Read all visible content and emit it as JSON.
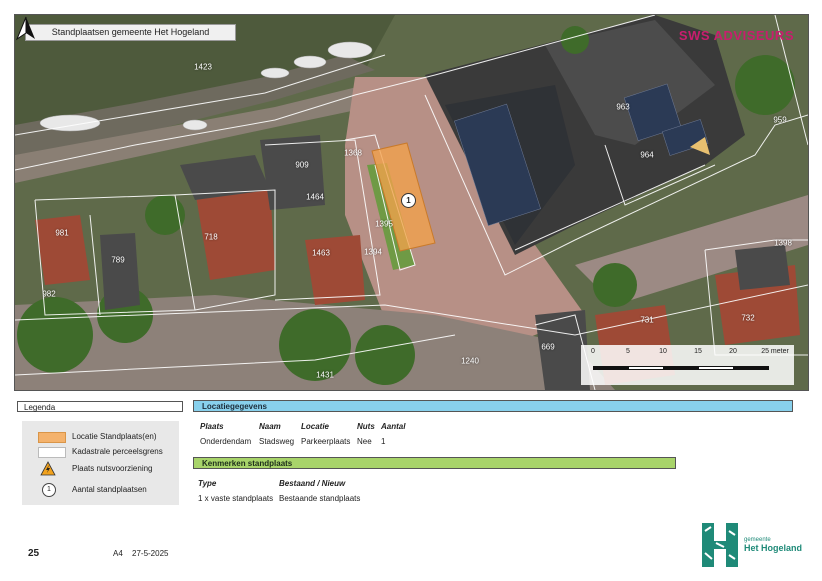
{
  "map": {
    "title": "Standplaatsen gemeente Het Hogeland",
    "brand": "SWS ADVISEURS",
    "parcel_labels": [
      "1423",
      "963",
      "959",
      "964",
      "909",
      "1368",
      "1464",
      "1395",
      "718",
      "1463",
      "1394",
      "981",
      "789",
      "982",
      "1398",
      "732",
      "731",
      "669",
      "1240",
      "1431"
    ],
    "site_marker": "1",
    "scale": {
      "ticks": [
        "0",
        "5",
        "10",
        "15",
        "20",
        "25 meter"
      ]
    },
    "colors": {
      "standplaats": "#f4b26c",
      "parcel_border": "#ffffff"
    }
  },
  "legend": {
    "title": "Legenda",
    "items": [
      {
        "symbol": "orange-rectangle",
        "label": "Locatie Standplaats(en)"
      },
      {
        "symbol": "white-rectangle",
        "label": "Kadastrale perceelsgrens"
      },
      {
        "symbol": "warning-icon",
        "label": "Plaats nutsvoorziening"
      },
      {
        "symbol": "number-circle",
        "symbol_text": "1",
        "label": "Aantal standplaatsen"
      }
    ]
  },
  "location": {
    "title": "Locatiegegevens",
    "headers": [
      "Plaats",
      "Naam",
      "Locatie",
      "Nuts",
      "Aantal"
    ],
    "row": [
      "Onderdendam",
      "Stadsweg",
      "Parkeerplaats",
      "Nee",
      "1"
    ]
  },
  "kenmerken": {
    "title": "Kenmerken standplaats",
    "headers": [
      "Type",
      "Bestaand / Nieuw"
    ],
    "row": [
      "1 x vaste standplaats",
      "Bestaande standplaats"
    ]
  },
  "footer": {
    "page_number": "25",
    "paper_size": "A4",
    "date": "27-5-2025",
    "municipality_small": "gemeente",
    "municipality_name": "Het Hogeland"
  }
}
